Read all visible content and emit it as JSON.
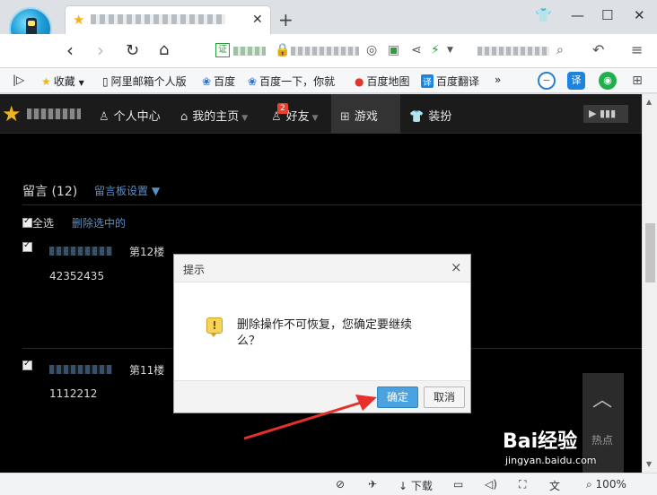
{
  "browser": {
    "tab": {
      "title_blurred": true
    },
    "address": {
      "cert_label": "证"
    },
    "bookmarks": [
      {
        "label": "收藏",
        "icon": "star-icon"
      },
      {
        "label": "阿里邮箱个人版",
        "icon": "page-icon"
      },
      {
        "label": "百度",
        "icon": "paw-icon"
      },
      {
        "label": "百度一下，你就",
        "icon": "paw-icon"
      },
      {
        "label": "百度地图",
        "icon": "map-pin-icon"
      },
      {
        "label": "百度翻译",
        "icon": "translate-icon"
      }
    ],
    "more": "»",
    "ext_translate": "译",
    "status": {
      "download": "下载",
      "zoom": "100%"
    }
  },
  "site_nav": {
    "items": [
      {
        "label": "个人中心",
        "icon": "user-icon"
      },
      {
        "label": "我的主页",
        "icon": "home-icon"
      },
      {
        "label": "好友",
        "icon": "friends-icon",
        "badge": "2"
      },
      {
        "label": "游戏",
        "icon": "grid-icon"
      },
      {
        "label": "装扮",
        "icon": "shirt-icon"
      }
    ]
  },
  "messages": {
    "title": "留言",
    "count": "(12)",
    "settings": "留言板设置",
    "select_all": "全选",
    "delete_selected": "删除选中的",
    "entries": [
      {
        "floor": "第12楼",
        "text": "42352435"
      },
      {
        "floor": "第11楼",
        "text": "1112212"
      }
    ]
  },
  "hot_panel": {
    "label": "热点"
  },
  "dialog": {
    "title": "提示",
    "close": "×",
    "message": "删除操作不可恢复，您确定要继续么？",
    "ok": "确定",
    "cancel": "取消"
  },
  "watermark": {
    "brand": "Bai经验",
    "url": "jingyan.baidu.com"
  },
  "colors": {
    "accent_link": "#5a8fc7",
    "ok_button": "#4aa3e0",
    "annotation_arrow": "#e8302a"
  }
}
